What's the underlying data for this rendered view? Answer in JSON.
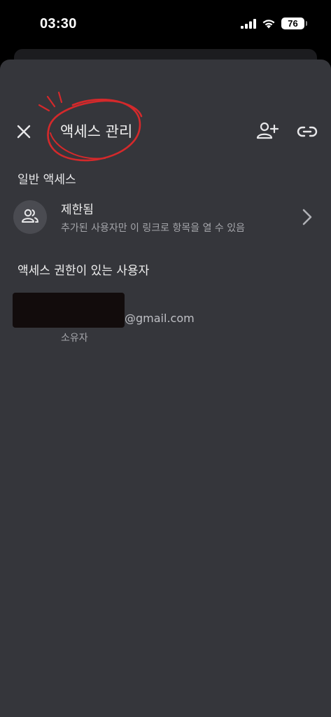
{
  "status_bar": {
    "time": "03:30",
    "battery": "76",
    "icons": [
      "signal-icon",
      "wifi-icon",
      "battery-icon"
    ]
  },
  "header": {
    "title": "액세스 관리",
    "close_icon": "close-icon",
    "add_user_icon": "add-person-icon",
    "link_icon": "link-icon",
    "annotation_color": "#d4292b"
  },
  "general_access": {
    "heading": "일반 액세스",
    "item": {
      "icon": "people-icon",
      "title": "제한됨",
      "description": "추가된 사용자만 이 링크로 항목을 열 수 있음"
    }
  },
  "users_with_access": {
    "heading": "액세스 권한이 있는 사용자",
    "users": [
      {
        "email": "@gmail.com",
        "role": "소유자"
      }
    ]
  },
  "colors": {
    "sheet_background": "#35363b",
    "text_primary": "#eeeeee",
    "text_secondary": "#a5a6ab"
  }
}
